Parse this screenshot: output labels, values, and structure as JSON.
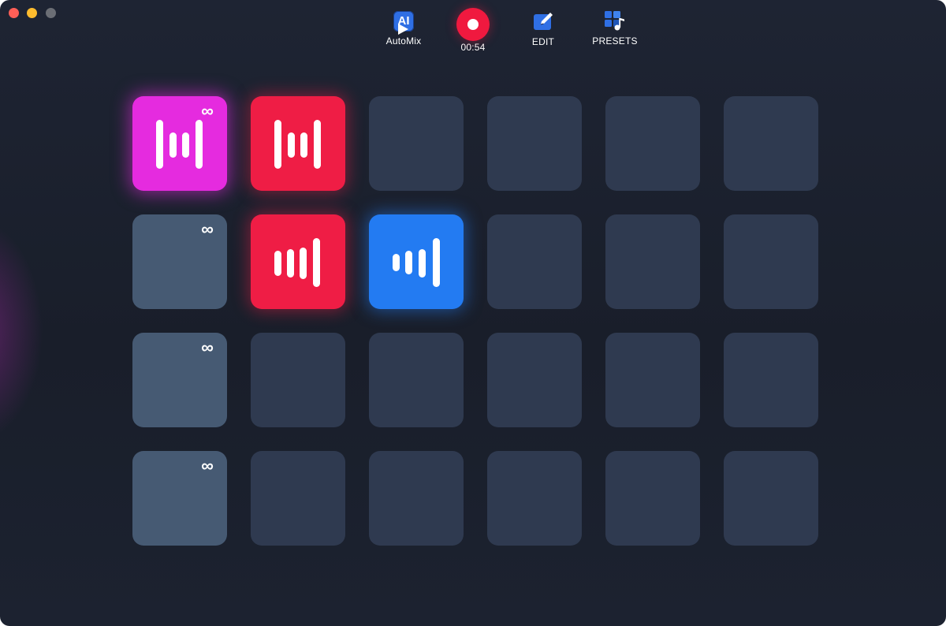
{
  "toolbar": {
    "automix": {
      "label": "AutoMix",
      "icon_text": "AI"
    },
    "record": {
      "time": "00:54"
    },
    "edit": {
      "label": "EDIT"
    },
    "presets": {
      "label": "PRESETS"
    }
  },
  "colors": {
    "pad_empty": "#2f3a50",
    "pad_loop": "#465a73",
    "magenta": "#e52bdf",
    "red": "#ef1d45",
    "blue": "#237bf2",
    "record": "#f0193f"
  },
  "loop_symbol": "∞",
  "grid": {
    "rows": [
      [
        {
          "state": "magenta",
          "loop": true,
          "wave": "full"
        },
        {
          "state": "red",
          "loop": false,
          "wave": "full"
        },
        {
          "state": "empty",
          "loop": false
        },
        {
          "state": "empty",
          "loop": false
        },
        {
          "state": "empty",
          "loop": false
        },
        {
          "state": "empty",
          "loop": false
        }
      ],
      [
        {
          "state": "loop",
          "loop": true
        },
        {
          "state": "red",
          "loop": false,
          "wave": "right"
        },
        {
          "state": "blue",
          "loop": false,
          "wave": "rising"
        },
        {
          "state": "empty",
          "loop": false
        },
        {
          "state": "empty",
          "loop": false
        },
        {
          "state": "empty",
          "loop": false
        }
      ],
      [
        {
          "state": "loop",
          "loop": true
        },
        {
          "state": "empty",
          "loop": false
        },
        {
          "state": "empty",
          "loop": false
        },
        {
          "state": "empty",
          "loop": false
        },
        {
          "state": "empty",
          "loop": false
        },
        {
          "state": "empty",
          "loop": false
        }
      ],
      [
        {
          "state": "loop",
          "loop": true
        },
        {
          "state": "empty",
          "loop": false
        },
        {
          "state": "empty",
          "loop": false
        },
        {
          "state": "empty",
          "loop": false
        },
        {
          "state": "empty",
          "loop": false
        },
        {
          "state": "empty",
          "loop": false
        }
      ]
    ]
  }
}
